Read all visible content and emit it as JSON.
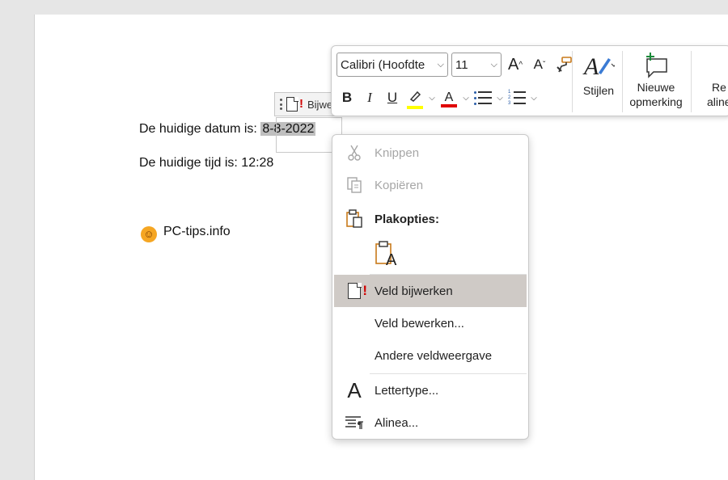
{
  "document": {
    "line1_prefix": "De huidige datum is:",
    "line1_field": "8-8-2022",
    "line2": "De huidige tijd is: 12:28",
    "line3": "PC-tips.info",
    "emoji": "☺",
    "field_tag_label": "Bijwe"
  },
  "toolbar": {
    "font_name": "Calibri (Hoofdte",
    "font_size": "11",
    "grow_font": "A",
    "shrink_font": "A",
    "bold": "B",
    "italic": "I",
    "underline": "U",
    "highlight_letter": "",
    "font_color_letter": "A",
    "styles_label": "Stijlen",
    "new_comment_label_1": "Nieuwe",
    "new_comment_label_2": "opmerking",
    "cut_off_label_1": "Re",
    "cut_off_label_2": "alinea",
    "highlight_color": "#ffff00",
    "font_color": "#e00000"
  },
  "context_menu": {
    "items": [
      {
        "label": "Knippen",
        "state": "disabled"
      },
      {
        "label": "Kopiëren",
        "state": "disabled"
      },
      {
        "label": "Plakopties:",
        "state": "header"
      },
      {
        "label": "Veld bijwerken",
        "state": "hover"
      },
      {
        "label": "Veld bewerken...",
        "state": "normal"
      },
      {
        "label": "Andere veldweergave",
        "state": "normal"
      },
      {
        "label": "Lettertype...",
        "state": "normal"
      },
      {
        "label": "Alinea...",
        "state": "normal"
      }
    ],
    "paste_option_letter": "A",
    "font_icon_letter": "A"
  },
  "colors": {
    "hover_bg": "#cfcac6",
    "field_shade": "#bfbfbf",
    "accent_red": "#d00000",
    "paste_orange": "#c87a1a"
  }
}
